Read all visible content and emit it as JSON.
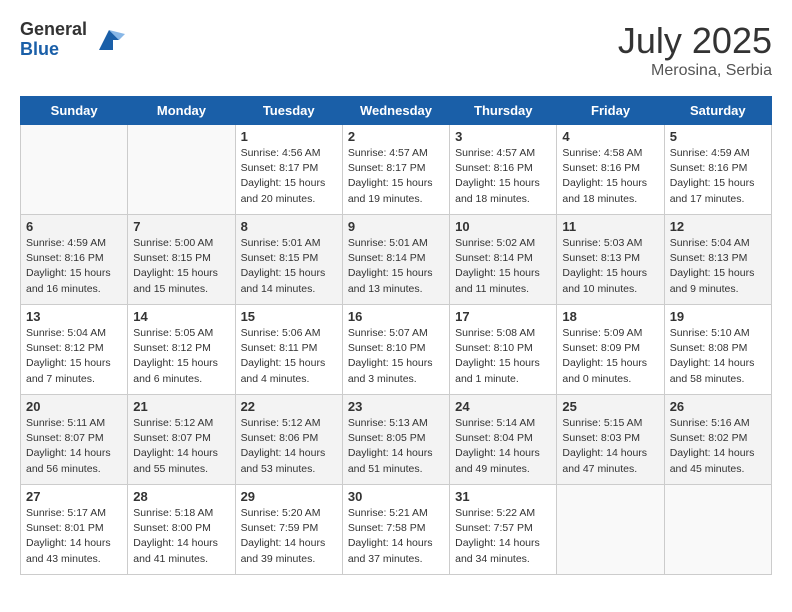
{
  "header": {
    "logo_general": "General",
    "logo_blue": "Blue",
    "month": "July 2025",
    "location": "Merosina, Serbia"
  },
  "weekdays": [
    "Sunday",
    "Monday",
    "Tuesday",
    "Wednesday",
    "Thursday",
    "Friday",
    "Saturday"
  ],
  "weeks": [
    [
      {
        "day": "",
        "detail": ""
      },
      {
        "day": "",
        "detail": ""
      },
      {
        "day": "1",
        "detail": "Sunrise: 4:56 AM\nSunset: 8:17 PM\nDaylight: 15 hours\nand 20 minutes."
      },
      {
        "day": "2",
        "detail": "Sunrise: 4:57 AM\nSunset: 8:17 PM\nDaylight: 15 hours\nand 19 minutes."
      },
      {
        "day": "3",
        "detail": "Sunrise: 4:57 AM\nSunset: 8:16 PM\nDaylight: 15 hours\nand 18 minutes."
      },
      {
        "day": "4",
        "detail": "Sunrise: 4:58 AM\nSunset: 8:16 PM\nDaylight: 15 hours\nand 18 minutes."
      },
      {
        "day": "5",
        "detail": "Sunrise: 4:59 AM\nSunset: 8:16 PM\nDaylight: 15 hours\nand 17 minutes."
      }
    ],
    [
      {
        "day": "6",
        "detail": "Sunrise: 4:59 AM\nSunset: 8:16 PM\nDaylight: 15 hours\nand 16 minutes."
      },
      {
        "day": "7",
        "detail": "Sunrise: 5:00 AM\nSunset: 8:15 PM\nDaylight: 15 hours\nand 15 minutes."
      },
      {
        "day": "8",
        "detail": "Sunrise: 5:01 AM\nSunset: 8:15 PM\nDaylight: 15 hours\nand 14 minutes."
      },
      {
        "day": "9",
        "detail": "Sunrise: 5:01 AM\nSunset: 8:14 PM\nDaylight: 15 hours\nand 13 minutes."
      },
      {
        "day": "10",
        "detail": "Sunrise: 5:02 AM\nSunset: 8:14 PM\nDaylight: 15 hours\nand 11 minutes."
      },
      {
        "day": "11",
        "detail": "Sunrise: 5:03 AM\nSunset: 8:13 PM\nDaylight: 15 hours\nand 10 minutes."
      },
      {
        "day": "12",
        "detail": "Sunrise: 5:04 AM\nSunset: 8:13 PM\nDaylight: 15 hours\nand 9 minutes."
      }
    ],
    [
      {
        "day": "13",
        "detail": "Sunrise: 5:04 AM\nSunset: 8:12 PM\nDaylight: 15 hours\nand 7 minutes."
      },
      {
        "day": "14",
        "detail": "Sunrise: 5:05 AM\nSunset: 8:12 PM\nDaylight: 15 hours\nand 6 minutes."
      },
      {
        "day": "15",
        "detail": "Sunrise: 5:06 AM\nSunset: 8:11 PM\nDaylight: 15 hours\nand 4 minutes."
      },
      {
        "day": "16",
        "detail": "Sunrise: 5:07 AM\nSunset: 8:10 PM\nDaylight: 15 hours\nand 3 minutes."
      },
      {
        "day": "17",
        "detail": "Sunrise: 5:08 AM\nSunset: 8:10 PM\nDaylight: 15 hours\nand 1 minute."
      },
      {
        "day": "18",
        "detail": "Sunrise: 5:09 AM\nSunset: 8:09 PM\nDaylight: 15 hours\nand 0 minutes."
      },
      {
        "day": "19",
        "detail": "Sunrise: 5:10 AM\nSunset: 8:08 PM\nDaylight: 14 hours\nand 58 minutes."
      }
    ],
    [
      {
        "day": "20",
        "detail": "Sunrise: 5:11 AM\nSunset: 8:07 PM\nDaylight: 14 hours\nand 56 minutes."
      },
      {
        "day": "21",
        "detail": "Sunrise: 5:12 AM\nSunset: 8:07 PM\nDaylight: 14 hours\nand 55 minutes."
      },
      {
        "day": "22",
        "detail": "Sunrise: 5:12 AM\nSunset: 8:06 PM\nDaylight: 14 hours\nand 53 minutes."
      },
      {
        "day": "23",
        "detail": "Sunrise: 5:13 AM\nSunset: 8:05 PM\nDaylight: 14 hours\nand 51 minutes."
      },
      {
        "day": "24",
        "detail": "Sunrise: 5:14 AM\nSunset: 8:04 PM\nDaylight: 14 hours\nand 49 minutes."
      },
      {
        "day": "25",
        "detail": "Sunrise: 5:15 AM\nSunset: 8:03 PM\nDaylight: 14 hours\nand 47 minutes."
      },
      {
        "day": "26",
        "detail": "Sunrise: 5:16 AM\nSunset: 8:02 PM\nDaylight: 14 hours\nand 45 minutes."
      }
    ],
    [
      {
        "day": "27",
        "detail": "Sunrise: 5:17 AM\nSunset: 8:01 PM\nDaylight: 14 hours\nand 43 minutes."
      },
      {
        "day": "28",
        "detail": "Sunrise: 5:18 AM\nSunset: 8:00 PM\nDaylight: 14 hours\nand 41 minutes."
      },
      {
        "day": "29",
        "detail": "Sunrise: 5:20 AM\nSunset: 7:59 PM\nDaylight: 14 hours\nand 39 minutes."
      },
      {
        "day": "30",
        "detail": "Sunrise: 5:21 AM\nSunset: 7:58 PM\nDaylight: 14 hours\nand 37 minutes."
      },
      {
        "day": "31",
        "detail": "Sunrise: 5:22 AM\nSunset: 7:57 PM\nDaylight: 14 hours\nand 34 minutes."
      },
      {
        "day": "",
        "detail": ""
      },
      {
        "day": "",
        "detail": ""
      }
    ]
  ]
}
